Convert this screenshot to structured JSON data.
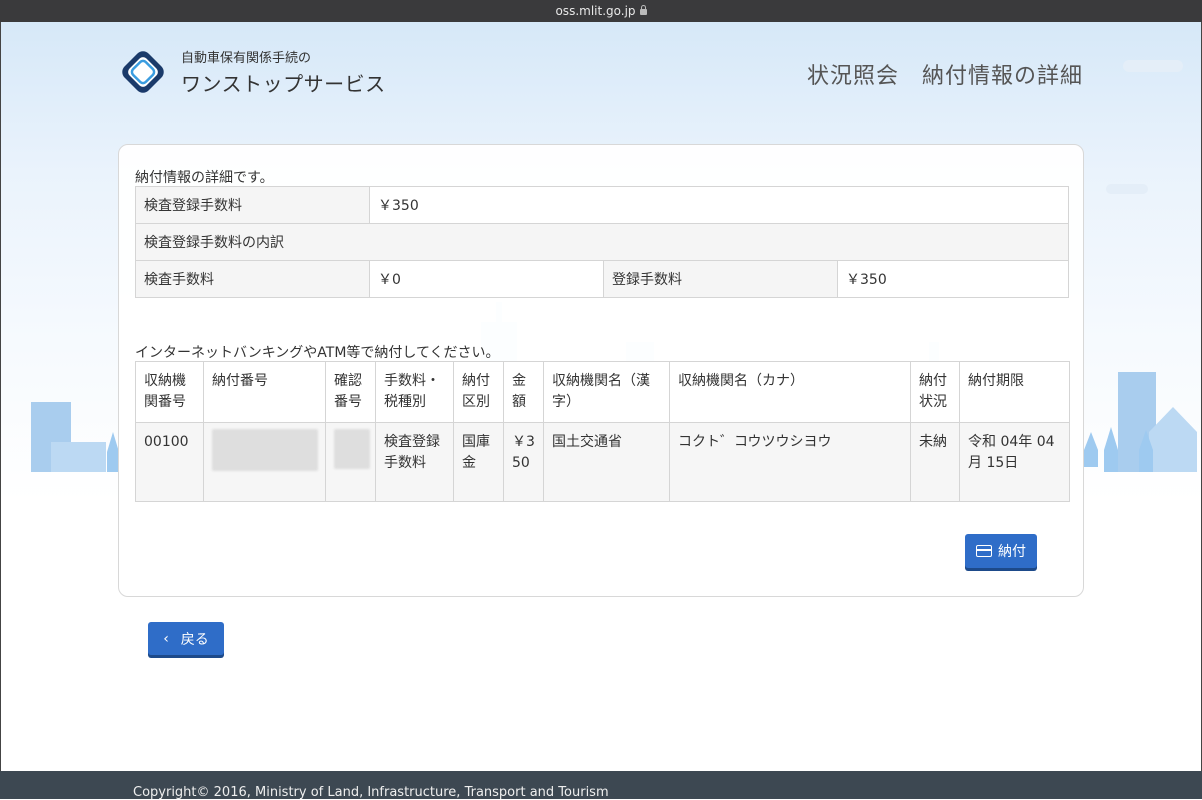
{
  "browser": {
    "url": "oss.mlit.go.jp"
  },
  "header": {
    "logo_sub": "自動車保有関係手続の",
    "logo_main": "ワンストップサービス",
    "page_title": "状況照会　納付情報の詳細"
  },
  "detail": {
    "intro": "納付情報の詳細です。",
    "fee_label": "検査登録手数料",
    "fee_value": "￥350",
    "breakdown_label": "検査登録手数料の内訳",
    "inspection_label": "検査手数料",
    "inspection_value": "￥0",
    "registration_label": "登録手数料",
    "registration_value": "￥350"
  },
  "payment": {
    "note": "インターネットバンキングやATM等で納付してください。",
    "columns": [
      "収納機関番号",
      "納付番号",
      "確認番号",
      "手数料・税種別",
      "納付区別",
      "金額",
      "収納機関名（漢字）",
      "収納機関名（カナ）",
      "納付状況",
      "納付期限"
    ],
    "rows": [
      {
        "agency_no": "00100",
        "type": "検査登録手数料",
        "category": "国庫金",
        "amount": "￥350",
        "agency_kanji": "国土交通省",
        "agency_kana": "コクト゛コウツウシヨウ",
        "status": "未納",
        "deadline": "令和 04年 04月 15日"
      }
    ],
    "pay_label": "納付",
    "pay_icon": "credit-card-icon"
  },
  "back_label": "戻る",
  "back_icon": "chevron-left-icon",
  "footer": {
    "copyright": "Copyright© 2016, Ministry of Land, Infrastructure, Transport and Tourism"
  },
  "colors": {
    "primary_button": "#2f6dc8",
    "footer_bg": "#3d4852",
    "url_bar_bg": "#3a3a3c"
  }
}
